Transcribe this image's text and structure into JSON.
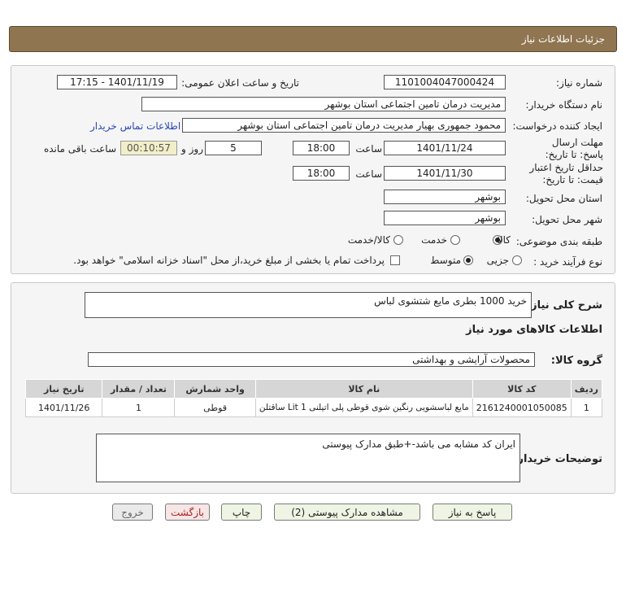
{
  "header": {
    "title": "جزئیات اطلاعات نیاز"
  },
  "form": {
    "need_number_label": "شماره نیاز:",
    "need_number": "1101004047000424",
    "announce_label": "تاریخ و ساعت اعلان عمومی:",
    "announce_value": "1401/11/19 - 17:15",
    "buyer_label": "نام دستگاه خریدار:",
    "buyer": "مدیریت درمان تامین اجتماعی استان بوشهر",
    "creator_label": "ایجاد کننده درخواست:",
    "creator": "محمود جمهوری بهیار مدیریت درمان تامین اجتماعی استان بوشهر",
    "contact_link": "اطلاعات تماس خریدار",
    "deadline_label": "مهلت ارسال پاسخ: تا تاریخ:",
    "deadline_date": "1401/11/24",
    "time_label": "ساعت",
    "deadline_time": "18:00",
    "days_value": "5",
    "days_label": "روز و",
    "remaining_time": "00:10:57",
    "remaining_label": "ساعت باقی مانده",
    "validity_label": "حداقل تاریخ اعتبار قیمت: تا تاریخ:",
    "validity_date": "1401/11/30",
    "validity_time": "18:00",
    "province_label": "استان محل تحویل:",
    "province": "بوشهر",
    "city_label": "شهر محل تحویل:",
    "city": "بوشهر",
    "category_label": "طبقه بندی موضوعی:",
    "category_options": [
      "کالا",
      "خدمت",
      "کالا/خدمت"
    ],
    "category_selected": "کالا",
    "process_label": "نوع فرآیند خرید :",
    "process_options": [
      "جزیی",
      "متوسط"
    ],
    "process_selected": "متوسط",
    "payment_note": "پرداخت تمام یا بخشی از مبلغ خرید،از محل \"اسناد خزانه اسلامی\" خواهد بود."
  },
  "description": {
    "summary_label": "شرح کلی نیاز:",
    "summary": "خرید 1000 بطری مایع شتشوی لباس",
    "goods_info_title": "اطلاعات کالاهای مورد نیاز",
    "group_label": "گروه کالا:",
    "group": "محصولات آرایشی و بهداشتی",
    "table": {
      "headers": [
        "ردیف",
        "کد کالا",
        "نام کالا",
        "واحد شمارش",
        "تعداد / مقدار",
        "تاریخ نیاز"
      ],
      "rows": [
        [
          "1",
          "2161240001050085",
          "مایع لباسشویی رنگین شوی قوطی پلی اتیلنی 1 Lit ساقتلن",
          "قوطی",
          "1",
          "1401/11/26"
        ]
      ]
    },
    "buyer_notes_label": "توضیحات خریدار:",
    "buyer_notes": "ایران کد مشابه می باشد-+طبق مدارک پیوستی"
  },
  "buttons": {
    "reply": "پاسخ به نیاز",
    "attachments": "مشاهده مدارک پیوستی (2)",
    "print": "چاپ",
    "back": "بازگشت",
    "exit": "خروج"
  }
}
